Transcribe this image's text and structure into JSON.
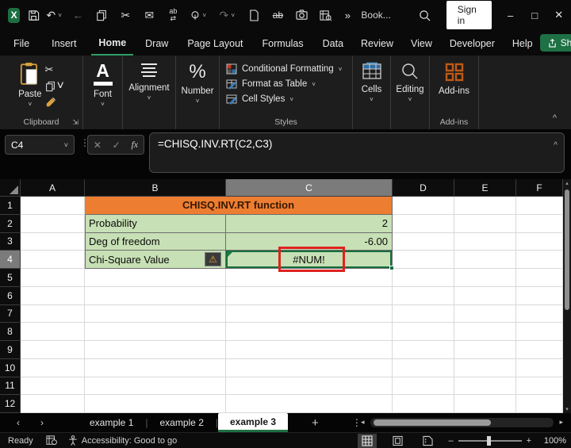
{
  "icons": {
    "excel_x": "X",
    "undo": "↶",
    "redo": "↷",
    "back": "←",
    "cut": "✂",
    "email": "✉",
    "replace_ab": "ab",
    "replace_arrows": "⇄",
    "strike_ab": "ab",
    "more": "»",
    "chevron_down": "˅",
    "dots": "⋮",
    "cancel": "✕",
    "check": "✓",
    "fx": "fx",
    "expand": "^",
    "percent": "%",
    "font_a": "A",
    "minimize": "–",
    "maximize": "□",
    "close": "✕",
    "warning": "⚠",
    "launcher": "⇲",
    "nav_left": "‹",
    "nav_right": "›",
    "add_sheet": "+",
    "hs_left": "◂",
    "hs_right": "▸",
    "vs_up": "▴",
    "vs_down": "▾",
    "zoom_minus": "–",
    "zoom_plus": "+"
  },
  "title_bar": {
    "workbook_name": "Book...",
    "sign_in": "Sign in"
  },
  "menu": {
    "tabs": [
      {
        "label": "File"
      },
      {
        "label": "Insert"
      },
      {
        "label": "Home"
      },
      {
        "label": "Draw"
      },
      {
        "label": "Page Layout"
      },
      {
        "label": "Formulas"
      },
      {
        "label": "Data"
      },
      {
        "label": "Review"
      },
      {
        "label": "View"
      },
      {
        "label": "Developer"
      },
      {
        "label": "Help"
      }
    ],
    "share": "Share"
  },
  "ribbon": {
    "paste": "Paste",
    "clipboard_group": "Clipboard",
    "font": "Font",
    "alignment": "Alignment",
    "number": "Number",
    "conditional_formatting": "Conditional Formatting",
    "format_as_table": "Format as Table",
    "cell_styles": "Cell Styles",
    "styles_group": "Styles",
    "cells": "Cells",
    "editing": "Editing",
    "addins": "Add-ins",
    "addins_group": "Add-ins"
  },
  "formula_bar": {
    "name_box": "C4",
    "formula": "=CHISQ.INV.RT(C2,C3)"
  },
  "sheet": {
    "columns": [
      "A",
      "B",
      "C",
      "D",
      "E",
      "F"
    ],
    "rows": [
      "1",
      "2",
      "3",
      "4",
      "5",
      "6",
      "7",
      "8",
      "9",
      "10",
      "11",
      "12"
    ],
    "title_cell": "CHISQ.INV.RT function",
    "data": [
      {
        "label": "Probability",
        "value": "2"
      },
      {
        "label": "Deg of freedom",
        "value": "-6.00"
      },
      {
        "label": "Chi-Square Value",
        "value": "#NUM!"
      }
    ],
    "selected_cell": "C4"
  },
  "tab_bar": {
    "tabs": [
      {
        "label": "example 1"
      },
      {
        "label": "example 2"
      },
      {
        "label": "example 3"
      }
    ]
  },
  "status_bar": {
    "ready": "Ready",
    "accessibility": "Accessibility: Good to go",
    "zoom": "100%"
  },
  "colors": {
    "accent_green": "#1e7145",
    "orange_fill": "#ED7D31",
    "green_fill": "#c7e0b5",
    "selection_green": "#176e3f",
    "annotation_red": "#e0221f",
    "warning_orange": "#eda33b"
  }
}
